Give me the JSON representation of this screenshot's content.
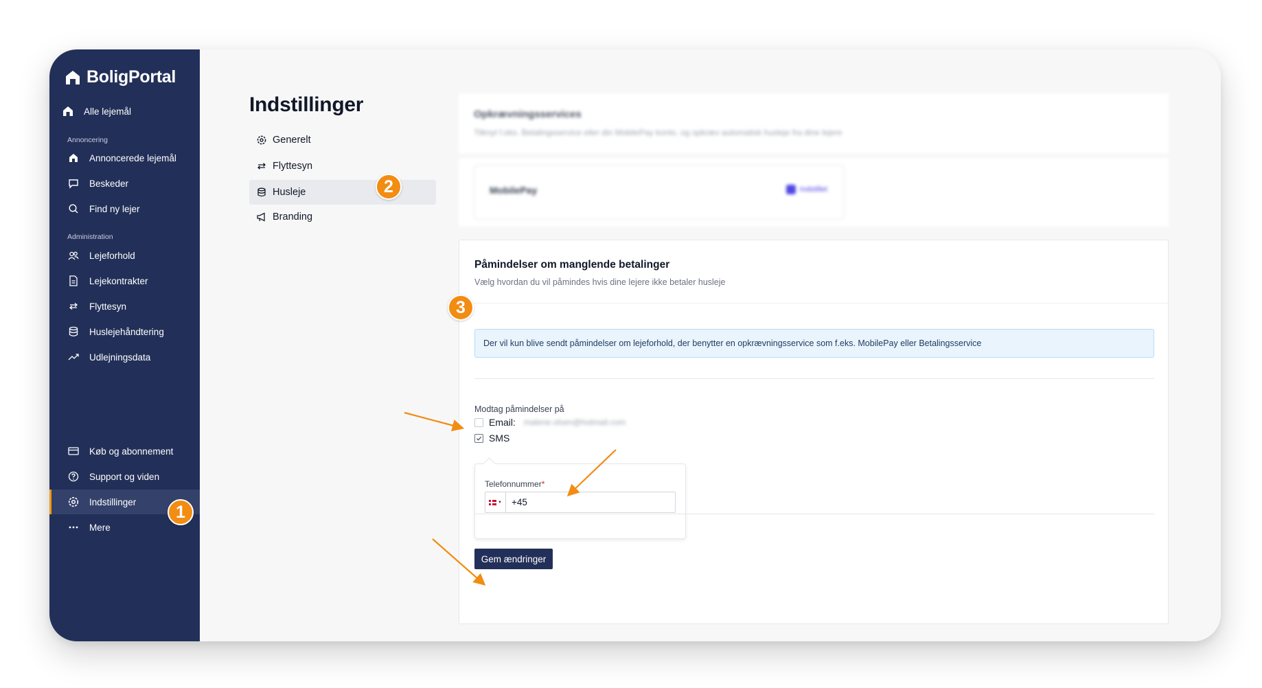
{
  "brand": {
    "name": "BoligPortal"
  },
  "sidebar": {
    "top_item": "Alle lejemål",
    "section_advertising": "Annoncering",
    "section_admin": "Administration",
    "items": [
      {
        "label": "Annoncerede lejemål",
        "icon": "house-icon"
      },
      {
        "label": "Beskeder",
        "icon": "chat-icon"
      },
      {
        "label": "Find ny lejer",
        "icon": "search-icon"
      },
      {
        "label": "Lejeforhold",
        "icon": "users-icon"
      },
      {
        "label": "Lejekontrakter",
        "icon": "document-icon"
      },
      {
        "label": "Flyttesyn",
        "icon": "swap-arrows-icon"
      },
      {
        "label": "Huslejehåndtering",
        "icon": "database-icon"
      },
      {
        "label": "Udlejningsdata",
        "icon": "trend-icon"
      }
    ],
    "bottom_items": [
      {
        "label": "Køb og abonnement",
        "icon": "card-icon"
      },
      {
        "label": "Support og viden",
        "icon": "help-icon"
      },
      {
        "label": "Indstillinger",
        "icon": "settings-icon",
        "active": true
      },
      {
        "label": "Mere",
        "icon": "more-icon"
      }
    ]
  },
  "settings": {
    "title": "Indstillinger",
    "menu": [
      {
        "label": "Generelt",
        "icon": "settings-icon"
      },
      {
        "label": "Flyttesyn",
        "icon": "swap-arrows-icon"
      },
      {
        "label": "Husleje",
        "icon": "database-icon",
        "active": true
      },
      {
        "label": "Branding",
        "icon": "megaphone-icon"
      }
    ]
  },
  "collection_card": {
    "title": "Opkrævningsservices",
    "subtitle": "Tilknyt f.eks. Betalingsservice eller din MobilePay konto, og opkræv automatisk husleje fra dine lejere",
    "provider_name": "MobilePay",
    "provider_badge": "Indstillet"
  },
  "reminders": {
    "title": "Påmindelser om manglende betalinger",
    "subtitle": "Vælg hvordan du vil påmindes hvis dine lejere ikke betaler husleje",
    "info": "Der vil kun blive sendt påmindelser om lejeforhold, der benytter en opkrævningsservice som f.eks. MobilePay eller Betalingsservice",
    "receive_label": "Modtag påmindelser på",
    "email_label": "Email:",
    "email_value": "malene.olsen@hotmail.com",
    "email_checked": false,
    "sms_label": "SMS",
    "sms_checked": true,
    "phone_label": "Telefonnummer",
    "phone_required_mark": "*",
    "phone_value": "+45",
    "save_label": "Gem ændringer"
  },
  "annotations": {
    "badge1": "1",
    "badge2": "2",
    "badge3": "3"
  },
  "colors": {
    "sidebar": "#223059",
    "accent": "#f28c13",
    "info_bg": "#e9f4fd"
  }
}
